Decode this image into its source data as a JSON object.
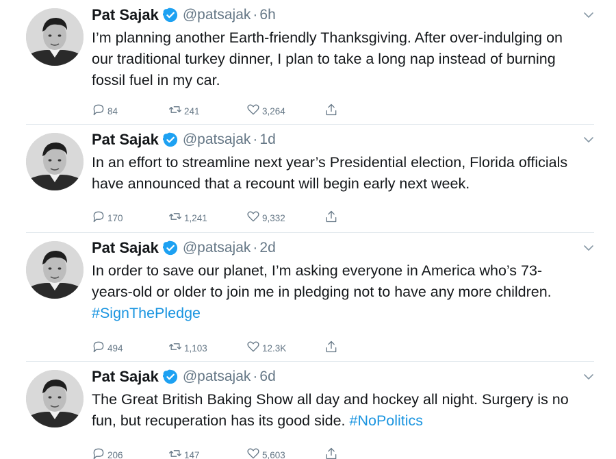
{
  "tweets": [
    {
      "name": "Pat Sajak",
      "handle": "@patsajak",
      "separator": "·",
      "time": "6h",
      "text_lines": [
        [
          {
            "text": "I’m planning another Earth-friendly Thanksgiving. After over-indulging on",
            "hashtag": false
          }
        ],
        [
          {
            "text": "our traditional turkey dinner, I plan to take a long nap instead of burning",
            "hashtag": false
          }
        ],
        [
          {
            "text": "fossil fuel in my car.",
            "hashtag": false
          }
        ]
      ],
      "replies": "84",
      "retweets": "241",
      "likes": "3,264"
    },
    {
      "name": "Pat Sajak",
      "handle": "@patsajak",
      "separator": "·",
      "time": "1d",
      "text_lines": [
        [
          {
            "text": "In an effort to streamline next year’s Presidential election, Florida officials",
            "hashtag": false
          }
        ],
        [
          {
            "text": "have announced that a recount will begin early next week.",
            "hashtag": false
          }
        ]
      ],
      "replies": "170",
      "retweets": "1,241",
      "likes": "9,332"
    },
    {
      "name": "Pat Sajak",
      "handle": "@patsajak",
      "separator": "·",
      "time": "2d",
      "text_lines": [
        [
          {
            "text": "In order to save our planet, I’m asking everyone in America who’s 73-",
            "hashtag": false
          }
        ],
        [
          {
            "text": "years-old or older to join me in pledging not to have any more children.",
            "hashtag": false
          }
        ],
        [
          {
            "text": "#SignThePledge",
            "hashtag": true
          }
        ]
      ],
      "replies": "494",
      "retweets": "1,103",
      "likes": "12.3K"
    },
    {
      "name": "Pat Sajak",
      "handle": "@patsajak",
      "separator": "·",
      "time": "6d",
      "text_lines": [
        [
          {
            "text": "The Great British Baking Show all day and hockey all night. Surgery is no",
            "hashtag": false
          }
        ],
        [
          {
            "text": "fun, but recuperation has its good side. ",
            "hashtag": false
          },
          {
            "text": "#NoPolitics",
            "hashtag": true
          }
        ]
      ],
      "replies": "206",
      "retweets": "147",
      "likes": "5,603"
    }
  ],
  "icons": {
    "avatar": "profile-photo",
    "verified": "verified-badge-icon",
    "caret": "chevron-down-icon",
    "reply": "reply-icon",
    "retweet": "retweet-icon",
    "like": "heart-icon",
    "share": "share-icon"
  },
  "colors": {
    "text": "#14171a",
    "muted": "#657786",
    "hashtag": "#1b95e0",
    "verified": "#1da1f2",
    "divider": "#e1e8ed"
  }
}
